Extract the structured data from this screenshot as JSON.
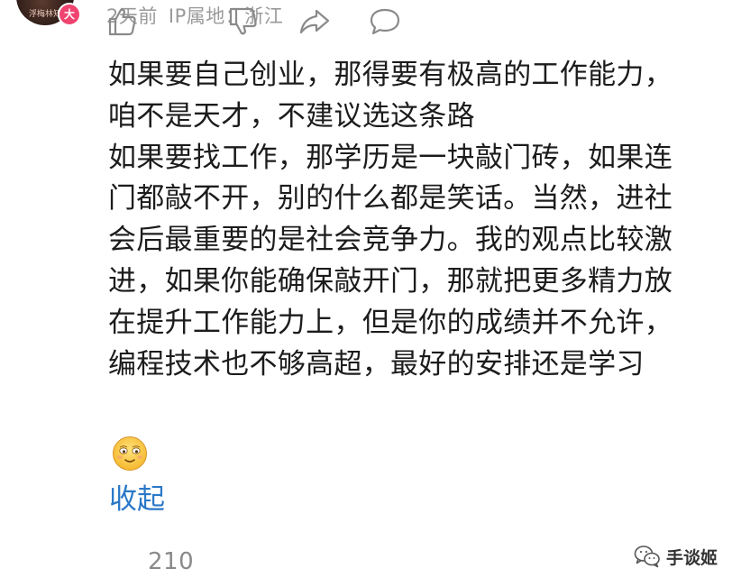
{
  "header": {
    "avatar_caption": "浮梅林知",
    "level_badge": "大",
    "time": "2天前",
    "ip_location": "IP属地：浙江"
  },
  "comment": {
    "lines": [
      "如果要自己创业，那得要有极高的工作能力，",
      "咱不是天才，不建议选这条路",
      "如果要找工作，那学历是一块敲门砖，如果连",
      "门都敲不开，别的什么都是笑话。当然，进社",
      "会后最重要的是社会竞争力。我的观点比较激",
      "进，如果你能确保敲开门，那就把更多精力放",
      "在提升工作能力上，但是你的成绩并不允许，",
      "编程技术也不够高超，最好的安排还是学习"
    ],
    "emoji": "smiling-face-emoji",
    "collapse_label": "收起"
  },
  "actions": {
    "like_count": "210",
    "icons": [
      "thumbs-up-icon",
      "thumbs-down-icon",
      "share-icon",
      "comment-icon"
    ]
  },
  "watermark": {
    "text": "手谈姬",
    "icon": "wechat-icon"
  },
  "colors": {
    "link": "#2a78c7",
    "meta": "#9a9a9a",
    "badge": "#f0436f",
    "icon": "#8a8a8a"
  }
}
